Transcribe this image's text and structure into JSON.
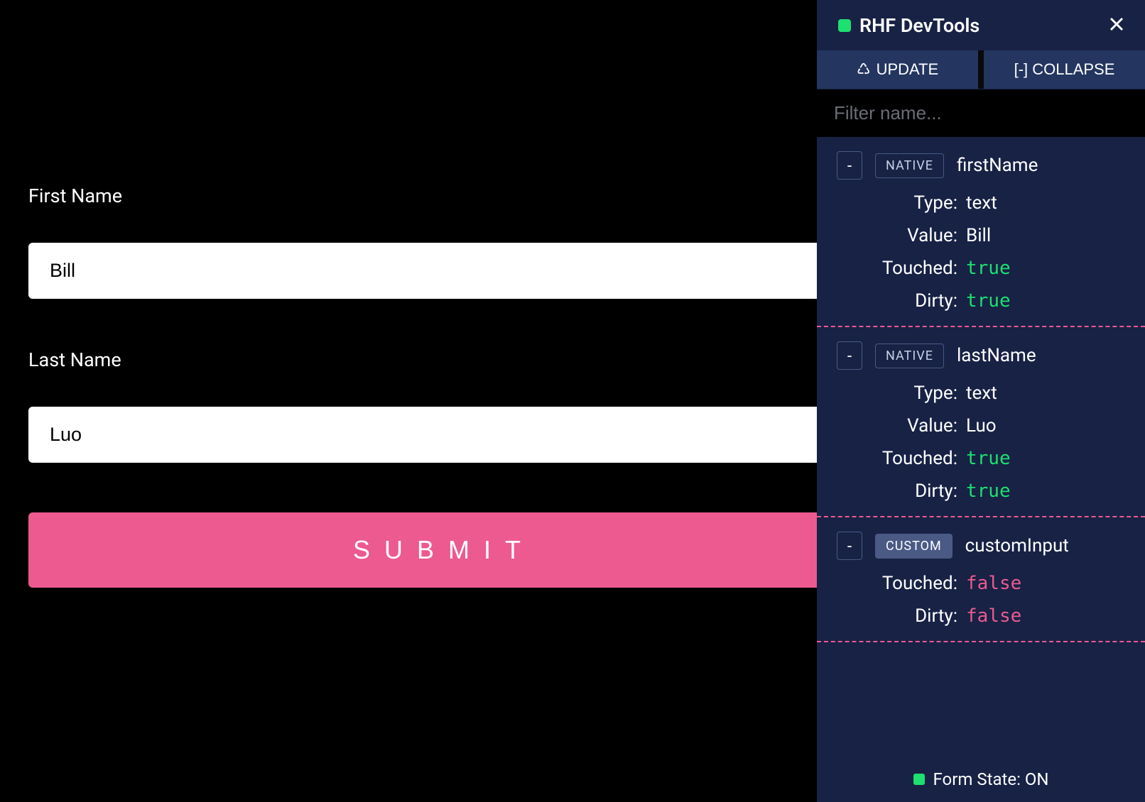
{
  "form": {
    "first_name_label": "First Name",
    "first_name_value": "Bill",
    "last_name_label": "Last Name",
    "last_name_value": "Luo",
    "submit_label": "SUBMIT"
  },
  "devtools": {
    "title": "RHF DevTools",
    "update_label": "UPDATE",
    "collapse_label": "[-] COLLAPSE",
    "filter_placeholder": "Filter name...",
    "fields": [
      {
        "badge": "NATIVE",
        "badge_type": "native",
        "name": "firstName",
        "props": [
          {
            "label": "Type:",
            "value": "text",
            "bool": null
          },
          {
            "label": "Value:",
            "value": "Bill",
            "bool": null
          },
          {
            "label": "Touched:",
            "value": "true",
            "bool": true
          },
          {
            "label": "Dirty:",
            "value": "true",
            "bool": true
          }
        ]
      },
      {
        "badge": "NATIVE",
        "badge_type": "native",
        "name": "lastName",
        "props": [
          {
            "label": "Type:",
            "value": "text",
            "bool": null
          },
          {
            "label": "Value:",
            "value": "Luo",
            "bool": null
          },
          {
            "label": "Touched:",
            "value": "true",
            "bool": true
          },
          {
            "label": "Dirty:",
            "value": "true",
            "bool": true
          }
        ]
      },
      {
        "badge": "CUSTOM",
        "badge_type": "custom",
        "name": "customInput",
        "props": [
          {
            "label": "Touched:",
            "value": "false",
            "bool": false
          },
          {
            "label": "Dirty:",
            "value": "false",
            "bool": false
          }
        ]
      }
    ],
    "footer_text": "Form State: ON"
  }
}
